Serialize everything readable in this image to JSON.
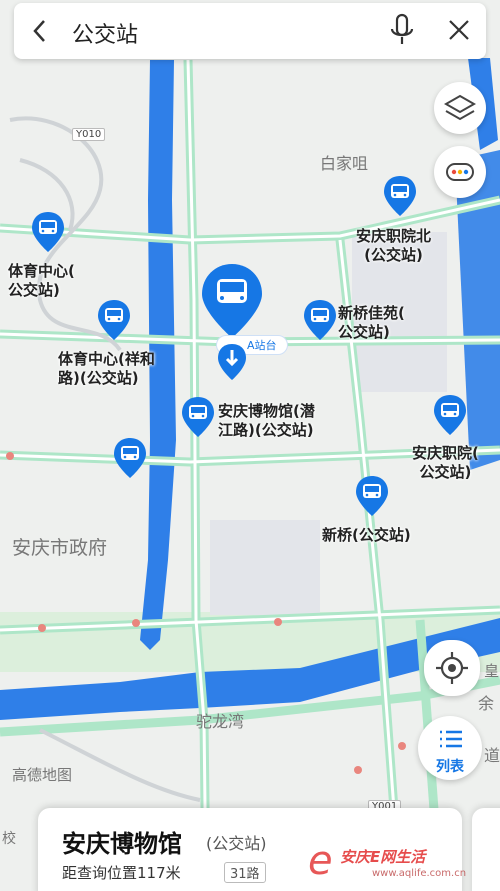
{
  "search": {
    "query": "公交站"
  },
  "map": {
    "areas": [
      "白家咀",
      "安庆市政府",
      "驼龙湾"
    ],
    "roads": [
      "Y010",
      "Y001"
    ],
    "attribution": "高德地图",
    "edge_texts": [
      "皇",
      "余",
      "道",
      "校"
    ]
  },
  "stops": [
    {
      "name": "体育中心(\n公交站)"
    },
    {
      "name": "体育中心(祥和\n路)(公交站)"
    },
    {
      "name": "安庆博物馆(潜\n江路)(公交站)"
    },
    {
      "name": "新桥佳苑(\n公交站)"
    },
    {
      "name": "安庆职院北\n(公交站)"
    },
    {
      "name": "安庆职院(\n公交站)"
    },
    {
      "name": "新桥(公交站)"
    }
  ],
  "selected": {
    "marker_label": "A站台"
  },
  "controls": {
    "list_label": "列表"
  },
  "card": {
    "title": "安庆博物馆",
    "category": "(公交站)",
    "distance": "距查询位置117米",
    "route": "31路"
  },
  "watermark": {
    "site": "安庆E网生活",
    "url": "www.aqlife.com.cn"
  },
  "colors": {
    "primary": "#1677e5",
    "road_stroke": "#aee6c8",
    "water": "#2f7fe8",
    "park": "#dcefdc"
  }
}
